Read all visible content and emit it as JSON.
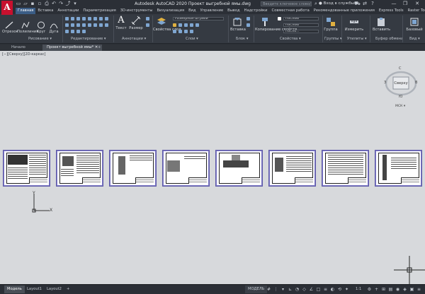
{
  "app": {
    "logo_letter": "A",
    "title": "Autodesk AutoCAD 2020    Проект выгребной ямы.dwg",
    "search_placeholder": "Введите ключевое слово/фразу",
    "signin": "Вход в службы",
    "window_controls": [
      "—",
      "❐",
      "✕"
    ]
  },
  "ribbon_tabs": [
    "Главная",
    "Вставка",
    "Аннотации",
    "Параметризация",
    "3D-инструменты",
    "Визуализация",
    "Вид",
    "Управление",
    "Вывод",
    "Надстройки",
    "Совместная работа",
    "Рекомендованные приложения",
    "Express Tools",
    "Raster Tools"
  ],
  "ribbon": {
    "draw": {
      "tools": [
        "Отрезок",
        "Полилиния",
        "Круг",
        "Дуга"
      ],
      "label": "Рисование ▾"
    },
    "modify": {
      "label": "Редактирование ▾"
    },
    "annotation": {
      "tools": [
        "Текст",
        "Размер"
      ],
      "label": "Аннотации ▾"
    },
    "layers": {
      "tool": "Свойства слоя",
      "combo": "Размерные штрихи",
      "label": "Слои ▾"
    },
    "block": {
      "tool": "Вставка",
      "label": "Блок ▾"
    },
    "properties": {
      "tool": "Копирование свойств",
      "combos": [
        "ПоСлою",
        "ПоСлою",
        "ПоСло..."
      ],
      "label": "Свойства ▾"
    },
    "groups": {
      "tool": "Группа",
      "label": "Группы ▾"
    },
    "utilities": {
      "tool": "Измерить",
      "label": "Утилиты ▾"
    },
    "clipboard": {
      "tool": "Вставить",
      "label": "Буфер обмена"
    },
    "view": {
      "tool": "Базовый",
      "label": "Вид ▾"
    }
  },
  "file_tabs": [
    "Начало",
    "Проект выгребной ямы*",
    "+"
  ],
  "drawing": {
    "viewport_label": "[−][Сверху][2D-каркас]",
    "sheet_count": 8,
    "viewcube": {
      "face": "Сверху",
      "north": "С",
      "south": "Ю",
      "east": "В",
      "west": "З",
      "wcs": "МСК ▾"
    },
    "ucs_x": "X",
    "ucs_y": "Y"
  },
  "status": {
    "layout_tabs": [
      "Модель",
      "Layout1",
      "Layout2",
      "+"
    ],
    "model_button": "МОДЕЛЬ",
    "scale": "1:1"
  },
  "colors": {
    "accent": "#3b5d86",
    "logo": "#c8102e",
    "sheet_border": "#5f5aa8",
    "canvas": "#d7d9dc"
  }
}
